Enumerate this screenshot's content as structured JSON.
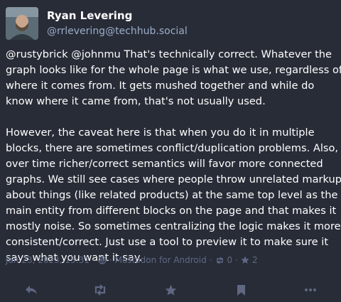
{
  "author": {
    "display_name": "Ryan Levering",
    "handle": "@rrlevering@techhub.social"
  },
  "post": {
    "lines_p1": [
      "@rustybrick @johnmu That's technically correct.  Whatever the",
      "graph looks like for the whole page is what we use, regardless of",
      "where it comes from.  It gets mushed together and while do",
      "know where it came from, that's not usually used."
    ],
    "lines_p2": [
      "However, the caveat here is that when you do it in multiple",
      "blocks, there are sometimes conflict/duplication problems.  Also,",
      "over time richer/correct semantics will favor more connected",
      "graphs.  We still see cases where people throw unrelated markup",
      "about things (like related products) at the same top level as the",
      "main entity from different blocks on the page and that makes it",
      "mostly noise.  So sometimes centralizing the logic makes it more",
      "consistent/correct.  Just use a tool to preview it to make sure it",
      "says what you want it say."
    ]
  },
  "meta": {
    "timestamp": "Jan 23, 2023, 15:31",
    "separator": "·",
    "client": "Mastodon for Android",
    "boost_count": "0",
    "favourite_count": "2"
  },
  "icons": [
    "globe-icon",
    "boost-icon",
    "star-icon",
    "reply-icon",
    "bookmark-icon",
    "more-icon"
  ],
  "colors": {
    "background": "#282c37",
    "text": "#ffffff",
    "handle": "#9baec8",
    "meta": "#606984",
    "action_icons": "#5f6781"
  }
}
